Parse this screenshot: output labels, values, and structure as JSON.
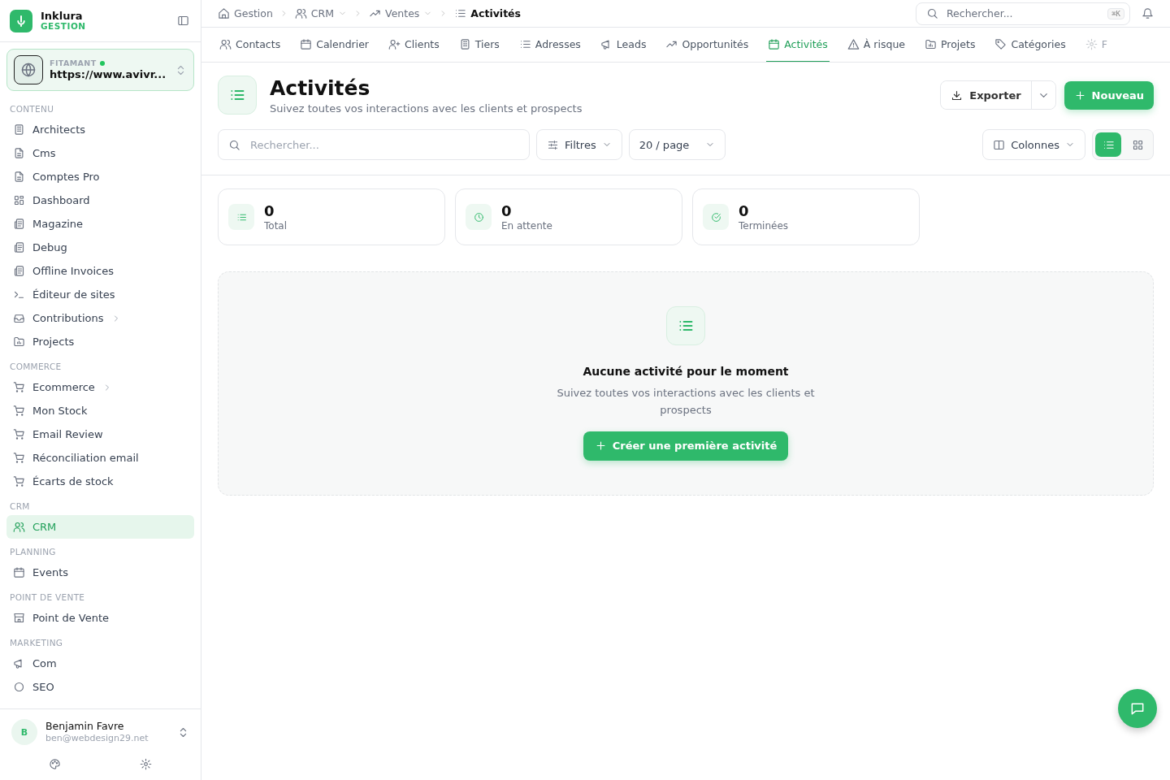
{
  "brand": {
    "name": "Inklura",
    "subtitle": "GESTION"
  },
  "site": {
    "label": "FITAMANT",
    "online": true,
    "url": "https://www.avivr..."
  },
  "sidebar": {
    "sections": [
      {
        "title": "CONTENU",
        "items": [
          {
            "label": "Architects",
            "selected": false,
            "expandable": false
          },
          {
            "label": "Cms",
            "selected": false,
            "expandable": false
          },
          {
            "label": "Comptes Pro",
            "selected": false,
            "expandable": false
          },
          {
            "label": "Dashboard",
            "selected": false,
            "expandable": false
          },
          {
            "label": "Magazine",
            "selected": false,
            "expandable": false
          },
          {
            "label": "Debug",
            "selected": false,
            "expandable": false
          },
          {
            "label": "Offline Invoices",
            "selected": false,
            "expandable": false
          },
          {
            "label": "Éditeur de sites",
            "selected": false,
            "expandable": false
          },
          {
            "label": "Contributions",
            "selected": false,
            "expandable": true
          },
          {
            "label": "Projects",
            "selected": false,
            "expandable": false
          }
        ]
      },
      {
        "title": "COMMERCE",
        "items": [
          {
            "label": "Ecommerce",
            "selected": false,
            "expandable": true
          },
          {
            "label": "Mon Stock",
            "selected": false,
            "expandable": false
          },
          {
            "label": "Email Review",
            "selected": false,
            "expandable": false
          },
          {
            "label": "Réconciliation email",
            "selected": false,
            "expandable": false
          },
          {
            "label": "Écarts de stock",
            "selected": false,
            "expandable": false
          }
        ]
      },
      {
        "title": "CRM",
        "items": [
          {
            "label": "CRM",
            "selected": true,
            "expandable": false
          }
        ]
      },
      {
        "title": "PLANNING",
        "items": [
          {
            "label": "Events",
            "selected": false,
            "expandable": false
          }
        ]
      },
      {
        "title": "POINT DE VENTE",
        "items": [
          {
            "label": "Point de Vente",
            "selected": false,
            "expandable": false
          }
        ]
      },
      {
        "title": "MARKETING",
        "items": [
          {
            "label": "Com",
            "selected": false,
            "expandable": false
          },
          {
            "label": "SEO",
            "selected": false,
            "expandable": false
          }
        ]
      }
    ]
  },
  "user": {
    "initial": "B",
    "name": "Benjamin Favre",
    "email": "ben@webdesign29.net"
  },
  "breadcrumb": [
    {
      "label": "Gestion",
      "dropdown": false,
      "current": false
    },
    {
      "label": "CRM",
      "dropdown": true,
      "current": false
    },
    {
      "label": "Ventes",
      "dropdown": true,
      "current": false
    },
    {
      "label": "Activités",
      "dropdown": false,
      "current": true
    }
  ],
  "global_search": {
    "placeholder": "Rechercher...",
    "shortcut": "⌘K"
  },
  "tabs": [
    {
      "label": "Contacts",
      "selected": false,
      "disabled": false
    },
    {
      "label": "Calendrier",
      "selected": false,
      "disabled": false
    },
    {
      "label": "Clients",
      "selected": false,
      "disabled": false
    },
    {
      "label": "Tiers",
      "selected": false,
      "disabled": false
    },
    {
      "label": "Adresses",
      "selected": false,
      "disabled": false
    },
    {
      "label": "Leads",
      "selected": false,
      "disabled": false
    },
    {
      "label": "Opportunités",
      "selected": false,
      "disabled": false
    },
    {
      "label": "Activités",
      "selected": true,
      "disabled": false
    },
    {
      "label": "À risque",
      "selected": false,
      "disabled": false
    },
    {
      "label": "Projets",
      "selected": false,
      "disabled": false
    },
    {
      "label": "Catégories",
      "selected": false,
      "disabled": false
    },
    {
      "label": "F",
      "selected": false,
      "disabled": true
    }
  ],
  "page": {
    "title": "Activités",
    "subtitle": "Suivez toutes vos interactions avec les clients et prospects",
    "export_label": "Exporter",
    "new_label": "Nouveau"
  },
  "toolbar": {
    "search_placeholder": "Rechercher...",
    "filters_label": "Filtres",
    "page_size": "20 / page",
    "columns_label": "Colonnes",
    "views": [
      {
        "kind": "list",
        "selected": true
      },
      {
        "kind": "grid",
        "selected": false
      }
    ]
  },
  "stats": [
    {
      "value": "0",
      "label": "Total"
    },
    {
      "value": "0",
      "label": "En attente"
    },
    {
      "value": "0",
      "label": "Terminées"
    }
  ],
  "empty_state": {
    "title": "Aucune activité pour le moment",
    "text": "Suivez toutes vos interactions avec les clients et prospects",
    "button": "Créer une première activité"
  }
}
